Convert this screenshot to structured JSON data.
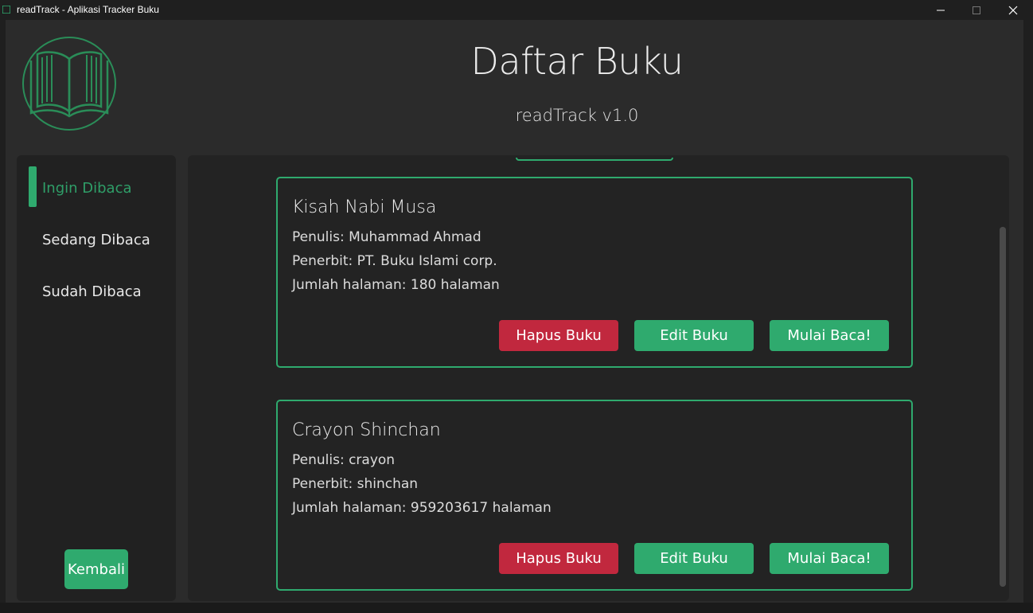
{
  "window": {
    "title": "readTrack - Aplikasi Tracker Buku",
    "icons": [
      "app-icon",
      "minimize-icon",
      "maximize-icon",
      "close-icon"
    ]
  },
  "header": {
    "title": "Daftar Buku",
    "subtitle": "readTrack v1.0",
    "logo_icon": "book-logo-icon"
  },
  "sidebar": {
    "items": [
      {
        "label": "Ingin Dibaca",
        "active": true
      },
      {
        "label": "Sedang Dibaca",
        "active": false
      },
      {
        "label": "Sudah Dibaca",
        "active": false
      }
    ],
    "back_label": "Kembali"
  },
  "books": [
    {
      "title": "Kisah Nabi Musa",
      "author": "Penulis: Muhammad Ahmad",
      "publisher": "Penerbit: PT. Buku Islami corp.",
      "pages": "Jumlah halaman: 180 halaman"
    },
    {
      "title": "Crayon Shinchan",
      "author": "Penulis: crayon",
      "publisher": "Penerbit: shinchan",
      "pages": "Jumlah halaman: 959203617 halaman"
    }
  ],
  "actions": {
    "delete_label": "Hapus Buku",
    "edit_label": "Edit Buku",
    "read_label": "Mulai Baca!"
  },
  "colors": {
    "accent": "#2faa6e",
    "danger": "#c1283e",
    "background": "#2b2b2b",
    "panel": "#232323"
  }
}
